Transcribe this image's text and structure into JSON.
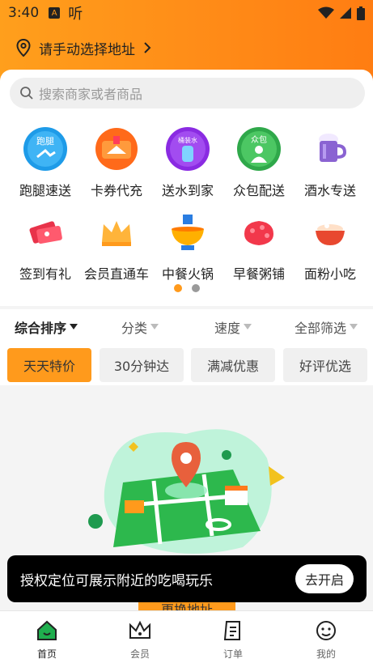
{
  "status_bar": {
    "time": "3:40",
    "app_glyph": "A",
    "listen_glyph": "听"
  },
  "location": {
    "label": "请手动选择地址"
  },
  "search": {
    "placeholder": "搜索商家或者商品"
  },
  "categories": [
    {
      "label": "跑腿速送",
      "icon": "errand-icon",
      "badge": "跑腿"
    },
    {
      "label": "卡券代充",
      "icon": "voucher-icon"
    },
    {
      "label": "送水到家",
      "icon": "water-delivery-icon",
      "badge": "桶装水"
    },
    {
      "label": "众包配送",
      "icon": "crowd-delivery-icon",
      "badge": "众包"
    },
    {
      "label": "酒水专送",
      "icon": "beer-icon"
    },
    {
      "label": "签到有礼",
      "icon": "checkin-icon"
    },
    {
      "label": "会员直通车",
      "icon": "crown-icon"
    },
    {
      "label": "中餐火锅",
      "icon": "hotpot-icon"
    },
    {
      "label": "早餐粥铺",
      "icon": "breakfast-icon"
    },
    {
      "label": "面粉小吃",
      "icon": "noodle-snack-icon"
    }
  ],
  "pager": {
    "active_color": "#ff9a1c",
    "inactive_color": "#999999"
  },
  "sort": {
    "comprehensive": "综合排序",
    "category": "分类",
    "speed": "速度",
    "all_filter": "全部筛选"
  },
  "chips": [
    {
      "label": "天天特价",
      "active": true
    },
    {
      "label": "30分钟达",
      "active": false
    },
    {
      "label": "满减优惠",
      "active": false
    },
    {
      "label": "好评优选",
      "active": false
    }
  ],
  "empty": {
    "button_label": "更换地址"
  },
  "toast": {
    "message": "授权定位可展示附近的吃喝玩乐",
    "action": "去开启"
  },
  "tabs": [
    {
      "label": "首页",
      "icon": "home-icon",
      "active": true
    },
    {
      "label": "会员",
      "icon": "crown-icon",
      "active": false
    },
    {
      "label": "订单",
      "icon": "order-icon",
      "active": false
    },
    {
      "label": "我的",
      "icon": "profile-icon",
      "active": false
    }
  ],
  "colors": {
    "brand": "#ff9a1c",
    "accent_green": "#2db84d"
  }
}
